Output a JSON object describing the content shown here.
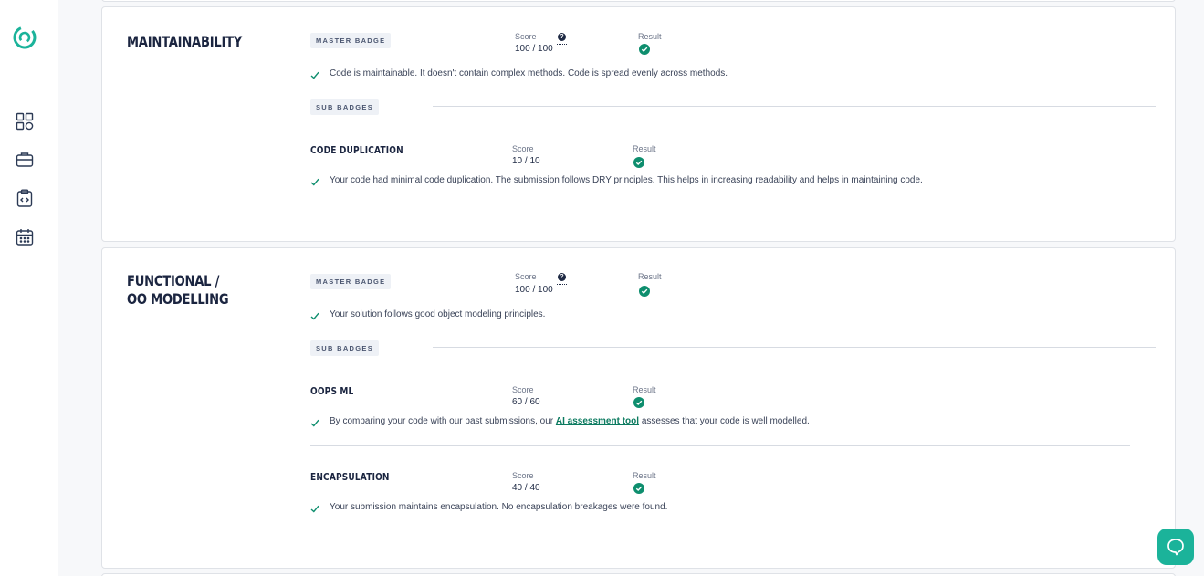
{
  "sidebar": {
    "nav": [
      {
        "icon": "dashboard-grid-icon"
      },
      {
        "icon": "briefcase-icon"
      },
      {
        "icon": "code-clipboard-icon"
      },
      {
        "icon": "calendar-icon"
      }
    ]
  },
  "sections": [
    {
      "title": "MAINTAINABILITY",
      "master": {
        "badge_label": "MASTER BADGE",
        "score_label": "Score",
        "score": "100 / 100",
        "help": "?",
        "result_label": "Result",
        "result": "passed",
        "description": "Code is maintainable. It doesn't contain complex methods. Code is spread evenly across methods."
      },
      "sub_badges_label": "SUB BADGES",
      "sub_badges": [
        {
          "title": "CODE DUPLICATION",
          "score_label": "Score",
          "score": "10 / 10",
          "result_label": "Result",
          "result": "passed",
          "description": "Your code had minimal code duplication. The submission follows DRY principles. This helps in increasing readability and helps in maintaining code."
        }
      ]
    },
    {
      "title": "FUNCTIONAL / OO MODELLING",
      "master": {
        "badge_label": "MASTER BADGE",
        "score_label": "Score",
        "score": "100 / 100",
        "help": "?",
        "result_label": "Result",
        "result": "passed",
        "description": "Your solution follows good object modeling principles."
      },
      "sub_badges_label": "SUB BADGES",
      "sub_badges": [
        {
          "title": "OOPS ML",
          "score_label": "Score",
          "score": "60 / 60",
          "result_label": "Result",
          "result": "passed",
          "description_before": "By comparing your code with our past submissions, our ",
          "description_link": "AI assessment tool",
          "description_after": " assesses that your code is well modelled."
        },
        {
          "title": "ENCAPSULATION",
          "score_label": "Score",
          "score": "40 / 40",
          "result_label": "Result",
          "result": "passed",
          "description": "Your submission maintains encapsulation. No encapsulation breakages were found."
        }
      ]
    }
  ],
  "colors": {
    "accent": "#1bb39a",
    "success": "#0e8e6e",
    "text": "#1f2a44"
  }
}
